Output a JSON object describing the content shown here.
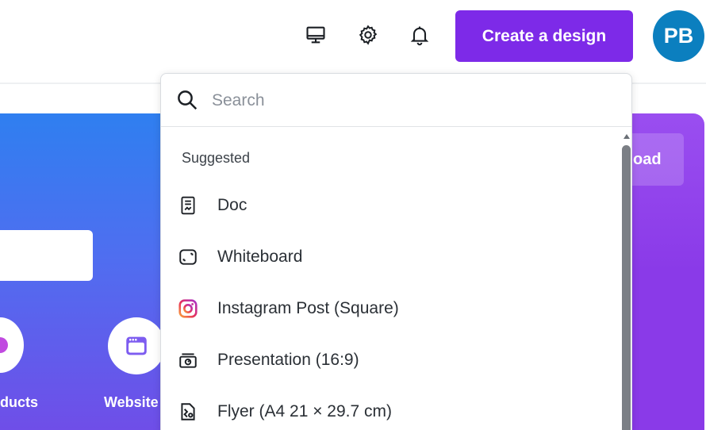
{
  "header": {
    "icons": [
      "desktop-icon",
      "gear-icon",
      "bell-icon"
    ],
    "create_button_label": "Create a design",
    "avatar_initials": "PB",
    "accent_color": "#7d2ae8",
    "avatar_color": "#0b7fbf"
  },
  "background": {
    "upload_label_partial": "oad",
    "categories": [
      {
        "label": "ducts"
      },
      {
        "label": "Website"
      }
    ]
  },
  "dropdown": {
    "search": {
      "placeholder": "Search",
      "value": ""
    },
    "section_title": "Suggested",
    "items": [
      {
        "label": "Doc",
        "icon": "doc-icon"
      },
      {
        "label": "Whiteboard",
        "icon": "whiteboard-icon"
      },
      {
        "label": "Instagram Post (Square)",
        "icon": "instagram-icon"
      },
      {
        "label": "Presentation (16:9)",
        "icon": "presentation-icon"
      },
      {
        "label": "Flyer (A4 21 × 29.7 cm)",
        "icon": "flyer-icon"
      }
    ]
  }
}
